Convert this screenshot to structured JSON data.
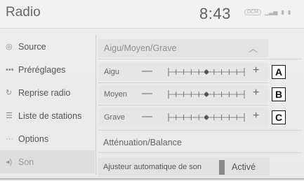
{
  "header": {
    "title": "Radio",
    "clock": "8:43",
    "status": {
      "dcm_label": "DCM",
      "signal": "signal-bars-icon",
      "phone": "phone-icon",
      "battery": "battery-icon"
    }
  },
  "sidebar": {
    "items": [
      {
        "label": "Source",
        "icon": "source-icon",
        "glyph": "◎"
      },
      {
        "label": "Préréglages",
        "icon": "presets-icon",
        "glyph": "▪▪▪"
      },
      {
        "label": "Reprise radio",
        "icon": "radio-resume-icon",
        "glyph": "↻"
      },
      {
        "label": "Liste de stations",
        "icon": "station-list-icon",
        "glyph": "☰"
      },
      {
        "label": "Options",
        "icon": "options-icon",
        "glyph": "···"
      },
      {
        "label": "Son",
        "icon": "sound-icon",
        "glyph": "◂)",
        "active": true
      }
    ]
  },
  "tone": {
    "header": "Aigu/Moyen/Grave",
    "rows": [
      {
        "label": "Aigu",
        "level": 0,
        "annotation": "A"
      },
      {
        "label": "Moyen",
        "level": 0,
        "annotation": "B"
      },
      {
        "label": "Grave",
        "level": 0,
        "annotation": "C"
      }
    ],
    "minus_label": "—",
    "plus_label": "+",
    "range": [
      -5,
      5
    ]
  },
  "balance": {
    "title": "Atténuation/Balance",
    "auto_label": "Ajusteur automatique de son",
    "auto_value": "Activé"
  }
}
